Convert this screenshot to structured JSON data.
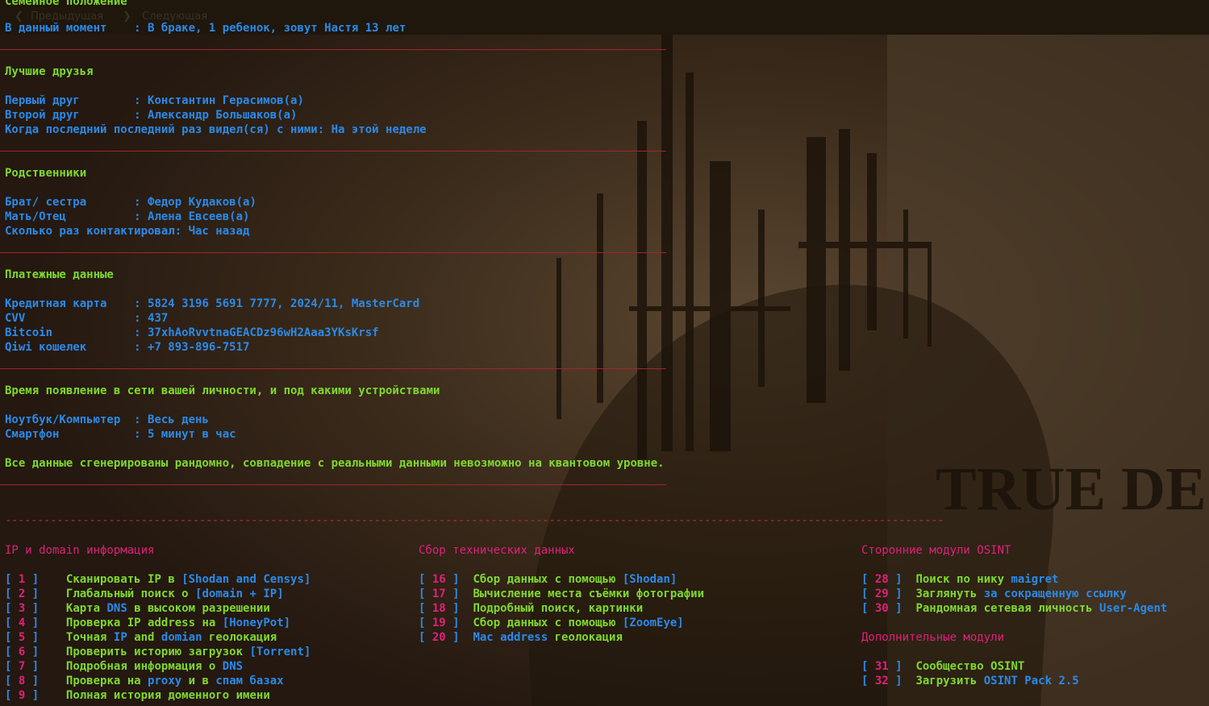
{
  "marital": {
    "heading": "Семейное положение",
    "k": "В данный момент    ",
    "v": ": В браке, 1 ребенок, зовут Настя 13 лет"
  },
  "friends": {
    "heading": "Лучшие друзья",
    "rows": [
      {
        "k": "Первый друг        ",
        "v": ": Константин Герасимов(а)"
      },
      {
        "k": "Второй друг        ",
        "v": ": Александр Большаков(а)"
      },
      {
        "k": "Когда последний последний раз видел(ся) с ними",
        "v": ": На этой неделе"
      }
    ]
  },
  "relatives": {
    "heading": "Родственники",
    "rows": [
      {
        "k": "Брат/ сестра       ",
        "v": ": Федор Кудаков(а)"
      },
      {
        "k": "Мать/Отец          ",
        "v": ": Алена Евсеев(а)"
      },
      {
        "k": "Сколько раз контактировал",
        "v": ": Час назад"
      }
    ]
  },
  "payment": {
    "heading": "Платежные данные",
    "rows": [
      {
        "k": "Кредитная карта    ",
        "v": ": 5824 3196 5691 7777, 2024/11, MasterCard"
      },
      {
        "k": "CVV                ",
        "v": ": 437"
      },
      {
        "k": "Bitcoin            ",
        "v": ": 37xhAoRvvtnaGEACDz96wH2Aaa3YKsKrsf"
      },
      {
        "k": "Qiwi кошелек       ",
        "v": ": +7 893-896-7517"
      }
    ]
  },
  "online": {
    "heading": "Время появление в сети вашей личности, и под какими устройствами",
    "rows": [
      {
        "k": "Ноутбук/Компьютер  ",
        "v": ": Весь день"
      },
      {
        "k": "Смартфон           ",
        "v": ": 5 минут в час"
      }
    ],
    "disclaimer": "Все данные сгенерированы рандомно, совпадение с реальными данными невозможно на квантовом уровне."
  },
  "divider": "-------------------------------------------------------------------------------------------------------------------------------------------------",
  "background_text": "TRUE DE",
  "ghost_toolbar": [
    "Предыдущая",
    "Следующая"
  ],
  "menu": {
    "col1": {
      "title": "IP и domain информация",
      "items": [
        {
          "n": "1",
          "parts": [
            [
              "g",
              "Сканировать IP в "
            ],
            [
              "b",
              "[Shodan and Censys]"
            ]
          ]
        },
        {
          "n": "2",
          "parts": [
            [
              "g",
              "Глабальный поиск о "
            ],
            [
              "b",
              "[domain + IP]"
            ]
          ]
        },
        {
          "n": "3",
          "parts": [
            [
              "g",
              "Карта "
            ],
            [
              "b",
              "DNS"
            ],
            [
              "g",
              " в высоком разрешении"
            ]
          ]
        },
        {
          "n": "4",
          "parts": [
            [
              "g",
              "Проверка IP address на "
            ],
            [
              "b",
              "[HoneyPot]"
            ]
          ]
        },
        {
          "n": "5",
          "parts": [
            [
              "g",
              "Точная "
            ],
            [
              "b",
              "IP"
            ],
            [
              "g",
              " and "
            ],
            [
              "b",
              "domian"
            ],
            [
              "g",
              " геолокация"
            ]
          ]
        },
        {
          "n": "6",
          "parts": [
            [
              "g",
              "Проверить историю загрузок "
            ],
            [
              "b",
              "[Torrent]"
            ]
          ]
        },
        {
          "n": "7",
          "parts": [
            [
              "g",
              "Подробная информация о "
            ],
            [
              "b",
              "DNS"
            ]
          ]
        },
        {
          "n": "8",
          "parts": [
            [
              "g",
              "Проверка на "
            ],
            [
              "b",
              "proxy"
            ],
            [
              "g",
              " и в "
            ],
            [
              "b",
              "спам базах"
            ]
          ]
        },
        {
          "n": "9",
          "parts": [
            [
              "g",
              "Полная история доменного имени"
            ]
          ]
        }
      ]
    },
    "col2": {
      "title": "Сбор технических данных",
      "items": [
        {
          "n": "16",
          "parts": [
            [
              "g",
              "Сбор данных с помощью "
            ],
            [
              "b",
              "[Shodan]"
            ]
          ]
        },
        {
          "n": "17",
          "parts": [
            [
              "g",
              "Вычисление места съёмки фотографии"
            ]
          ]
        },
        {
          "n": "18",
          "parts": [
            [
              "g",
              "Подробный поиск, картинки"
            ]
          ]
        },
        {
          "n": "19",
          "parts": [
            [
              "g",
              "Сбор данных с помощью "
            ],
            [
              "b",
              "[ZoomEye]"
            ]
          ]
        },
        {
          "n": "20",
          "parts": [
            [
              "b",
              "Mac address"
            ],
            [
              "g",
              " геолокация"
            ]
          ]
        }
      ]
    },
    "col3": {
      "title": "Сторонние модули OSINT",
      "items": [
        {
          "n": "28",
          "parts": [
            [
              "g",
              "Поиск по нику "
            ],
            [
              "b",
              "maigret"
            ]
          ]
        },
        {
          "n": "29",
          "parts": [
            [
              "g",
              "Заглянуть "
            ],
            [
              "b",
              "за сокращенную ссылку"
            ]
          ]
        },
        {
          "n": "30",
          "parts": [
            [
              "g",
              "Рандомная сетевая личность "
            ],
            [
              "b",
              "User-Agent"
            ]
          ]
        }
      ],
      "title2": "Дополнительные модули",
      "items2": [
        {
          "n": "31",
          "parts": [
            [
              "g",
              "Сообщество OSINT"
            ]
          ]
        },
        {
          "n": "32",
          "parts": [
            [
              "g",
              "Загрузить "
            ],
            [
              "b",
              "OSINT Pack 2.5"
            ]
          ]
        }
      ]
    }
  }
}
